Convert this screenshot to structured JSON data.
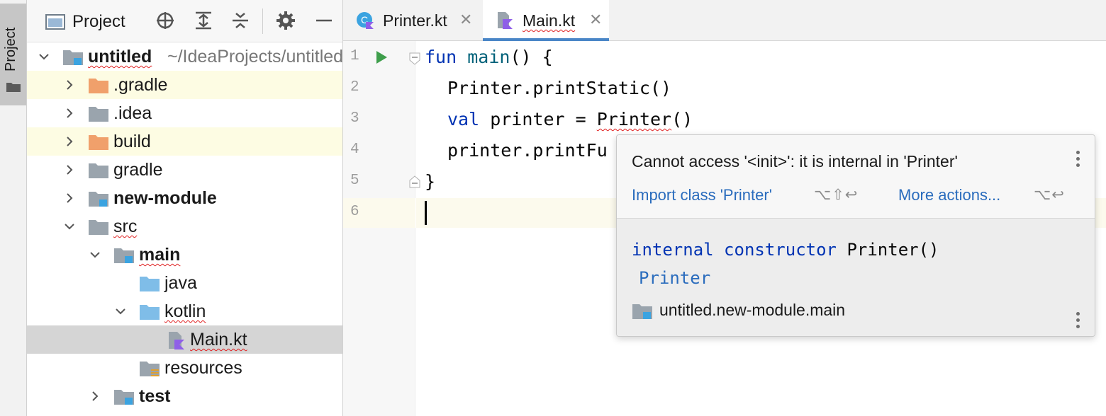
{
  "toolstrip": {
    "project_tab_label": "Project"
  },
  "project_panel": {
    "title": "Project",
    "tree": [
      {
        "label": "untitled",
        "path": "~/IdeaProjects/untitled",
        "bold": true,
        "squiggle": true,
        "expanded": true,
        "icon": "module-folder-icon"
      },
      {
        "label": ".gradle",
        "expanded": false,
        "icon": "orange-folder-icon"
      },
      {
        "label": ".idea",
        "expanded": false,
        "icon": "gray-folder-icon"
      },
      {
        "label": "build",
        "expanded": false,
        "icon": "orange-folder-icon"
      },
      {
        "label": "gradle",
        "expanded": false,
        "icon": "gray-folder-icon"
      },
      {
        "label": "new-module",
        "bold": true,
        "expanded": false,
        "icon": "module-folder-icon"
      },
      {
        "label": "src",
        "squiggle": true,
        "expanded": true,
        "icon": "gray-folder-icon"
      },
      {
        "label": "main",
        "bold": true,
        "squiggle": true,
        "expanded": true,
        "icon": "module-folder-icon"
      },
      {
        "label": "java",
        "icon": "source-folder-icon"
      },
      {
        "label": "kotlin",
        "squiggle": true,
        "expanded": true,
        "icon": "source-folder-icon"
      },
      {
        "label": "Main.kt",
        "squiggle": true,
        "selected": true,
        "icon": "kotlin-file-icon"
      },
      {
        "label": "resources",
        "icon": "resources-folder-icon"
      },
      {
        "label": "test",
        "bold": true,
        "expanded": false,
        "icon": "module-folder-icon"
      }
    ]
  },
  "editor": {
    "tabs": [
      {
        "label": "Printer.kt",
        "icon": "kotlin-class-icon",
        "active": false
      },
      {
        "label": "Main.kt",
        "icon": "kotlin-file-icon",
        "active": true
      }
    ],
    "line_numbers": [
      "1",
      "2",
      "3",
      "4",
      "5",
      "6"
    ],
    "code": {
      "l1_kw": "fun",
      "l1_fn": "main",
      "l1_rest": "() {",
      "l2": "Printer.printStatic()",
      "l3_kw": "val",
      "l3_mid": " printer = ",
      "l3_err": "Printer",
      "l3_rest": "()",
      "l4": "printer.printFu",
      "l5": "}"
    }
  },
  "popup": {
    "error": "Cannot access '<init>': it is internal in 'Printer'",
    "import_action": "Import class 'Printer'",
    "import_shortcut": "⌥⇧↩",
    "more_actions": "More actions...",
    "more_shortcut": "⌥↩",
    "decl_kw1": "internal",
    "decl_kw2": "constructor",
    "decl_name": "Printer()",
    "class_name": "Printer",
    "module": "untitled.new-module.main"
  }
}
